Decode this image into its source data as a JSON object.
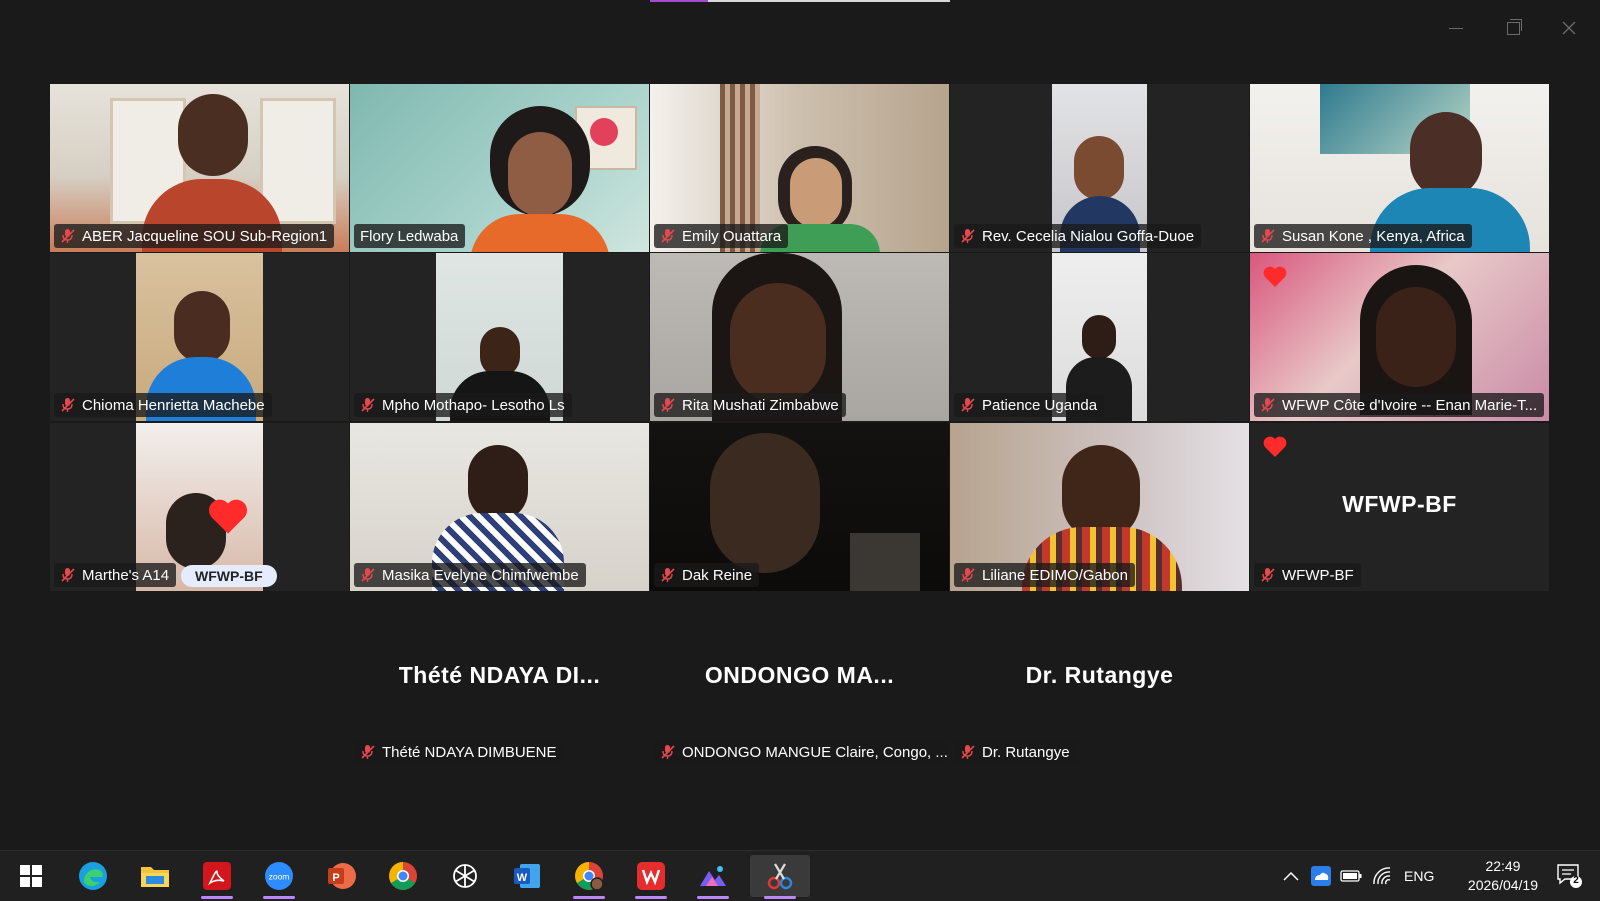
{
  "window": {
    "controls": [
      "minimize",
      "restore",
      "close"
    ]
  },
  "participants": [
    {
      "name": "ABER Jacqueline SOU Sub-Region1",
      "muted": true
    },
    {
      "name": "Flory Ledwaba",
      "muted": false,
      "speaking": true
    },
    {
      "name": "Emily Ouattara",
      "muted": true
    },
    {
      "name": "Rev. Cecelia Nialou Goffa-Duoe",
      "muted": true
    },
    {
      "name": "Susan Kone , Kenya, Africa",
      "muted": true
    },
    {
      "name": "Chioma Henrietta Machebe",
      "muted": true
    },
    {
      "name": "Mpho Mothapo- Lesotho Ls",
      "muted": true
    },
    {
      "name": "Rita Mushati Zimbabwe",
      "muted": true
    },
    {
      "name": "Patience Uganda",
      "muted": true
    },
    {
      "name": "WFWP Côte d'Ivoire -- Enan Marie-T...",
      "muted": true
    },
    {
      "name": "Marthe's A14",
      "muted": true,
      "badge": "WFWP-BF"
    },
    {
      "name": "Masika Evelyne Chimfwembe",
      "muted": true
    },
    {
      "name": "Dak Reine",
      "muted": true
    },
    {
      "name": "Liliane EDIMO/Gabon",
      "muted": true
    },
    {
      "name": "WFWP-BF",
      "muted": true,
      "display": "WFWP-BF"
    }
  ],
  "audio_only": [
    {
      "display": "Thété NDAYA DI...",
      "name": "Thété NDAYA DIMBUENE"
    },
    {
      "display": "ONDONGO MA...",
      "name": "ONDONGO MANGUE Claire, Congo, ..."
    },
    {
      "display": "Dr. Rutangye",
      "name": "Dr. Rutangye"
    }
  ],
  "taskbar": {
    "apps": [
      "windows-start",
      "edge",
      "file-explorer",
      "acrobat",
      "zoom",
      "powerpoint",
      "chrome",
      "chatgpt",
      "word",
      "chrome-profile",
      "wps-office",
      "photos",
      "snipping-tool"
    ],
    "tray": {
      "language": "ENG",
      "time": "22:49",
      "date": "2026/04/19",
      "notifications": "2"
    }
  },
  "colors": {
    "speaking_border": "#23d160",
    "muted_icon": "#e5484d",
    "background": "#1a1a1a"
  }
}
